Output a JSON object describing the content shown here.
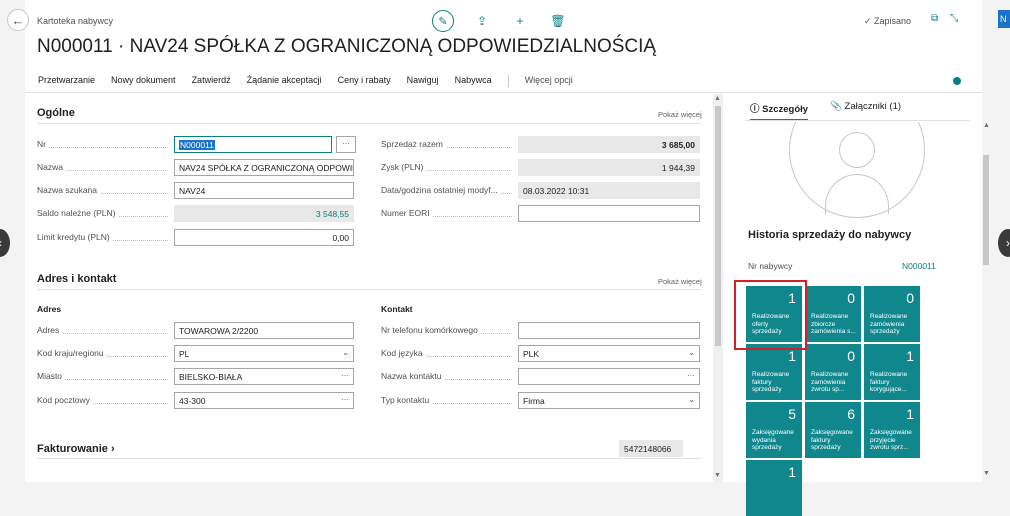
{
  "header": {
    "caption": "Kartoteka nabywcy",
    "title": "N000011 · NAV24 SPÓŁKA Z OGRANICZONĄ ODPOWIEDZIALNOŚCIĄ",
    "saved": "✓ Zapisano",
    "corner_tab": "N"
  },
  "actions": [
    "Przetwarzanie",
    "Nowy dokument",
    "Zatwierdź",
    "Żądanie akceptacji",
    "Ceny i rabaty",
    "Nawiguj",
    "Nabywca"
  ],
  "more_options": "Więcej opcji",
  "general": {
    "title": "Ogólne",
    "show_more": "Pokaż więcej",
    "left": [
      {
        "label": "Nr",
        "value": "N000011"
      },
      {
        "label": "Nazwa",
        "value": "NAV24 SPÓŁKA Z OGRANICZONĄ ODPOWIEI"
      },
      {
        "label": "Nazwa szukana",
        "value": "NAV24"
      },
      {
        "label": "Saldo należne (PLN)",
        "value": "3 548,55"
      },
      {
        "label": "Limit kredytu (PLN)",
        "value": "0,00"
      }
    ],
    "right": [
      {
        "label": "Sprzedaż razem",
        "value": "3 685,00"
      },
      {
        "label": "Zysk (PLN)",
        "value": "1 944,39"
      },
      {
        "label": "Data/godzina ostatniej modyf...",
        "value": "08.03.2022 10:31"
      },
      {
        "label": "Numer EORI",
        "value": ""
      }
    ],
    "lookup_label": "···"
  },
  "address": {
    "title": "Adres i kontakt",
    "show_more": "Pokaż więcej",
    "left_title": "Adres",
    "right_title": "Kontakt",
    "left": [
      {
        "label": "Adres",
        "value": "TOWAROWA 2/2200",
        "suffix": ""
      },
      {
        "label": "Kod kraju/regionu",
        "value": "PL",
        "suffix": "⌄"
      },
      {
        "label": "Miasto",
        "value": "BIELSKO-BIAŁA",
        "suffix": "···"
      },
      {
        "label": "Kod pocztowy",
        "value": "43-300",
        "suffix": "···"
      }
    ],
    "right": [
      {
        "label": "Nr telefonu komórkowego",
        "value": "",
        "suffix": ""
      },
      {
        "label": "Kod języka",
        "value": "PLK",
        "suffix": "⌄"
      },
      {
        "label": "Nazwa kontaktu",
        "value": "",
        "suffix": "···"
      },
      {
        "label": "Typ kontaktu",
        "value": "Firma",
        "suffix": "⌄"
      }
    ]
  },
  "invoicing": {
    "title": "Fakturowanie ›",
    "value": "5472148066"
  },
  "factbox": {
    "tab_details": "Szczegóły",
    "tab_attachments": "Załączniki (1)",
    "history_title": "Historia sprzedaży do nabywcy",
    "nr_label": "Nr nabywcy",
    "nr_value": "N000011",
    "tiles": [
      {
        "num": "1",
        "label": "Realizowane oferty sprzedaży"
      },
      {
        "num": "0",
        "label": "Realizowane zbiorcze zamówienia s..."
      },
      {
        "num": "0",
        "label": "Realizowane zamówienia sprzedaży"
      },
      {
        "num": "1",
        "label": "Realizowane faktury sprzedaży"
      },
      {
        "num": "0",
        "label": "Realizowane zamówienia zwrotu sp..."
      },
      {
        "num": "1",
        "label": "Realizowane faktury korygujące..."
      },
      {
        "num": "5",
        "label": "Zaksięgowane wydania sprzedaży"
      },
      {
        "num": "6",
        "label": "Zaksięgowane faktury sprzedaży"
      },
      {
        "num": "1",
        "label": "Zaksięgowane przyjęcie zwrotu sprz..."
      },
      {
        "num": "1",
        "label": ""
      }
    ]
  },
  "colors": {
    "accent": "#0a8080",
    "tile": "#10878d",
    "highlight": "#d32027"
  }
}
